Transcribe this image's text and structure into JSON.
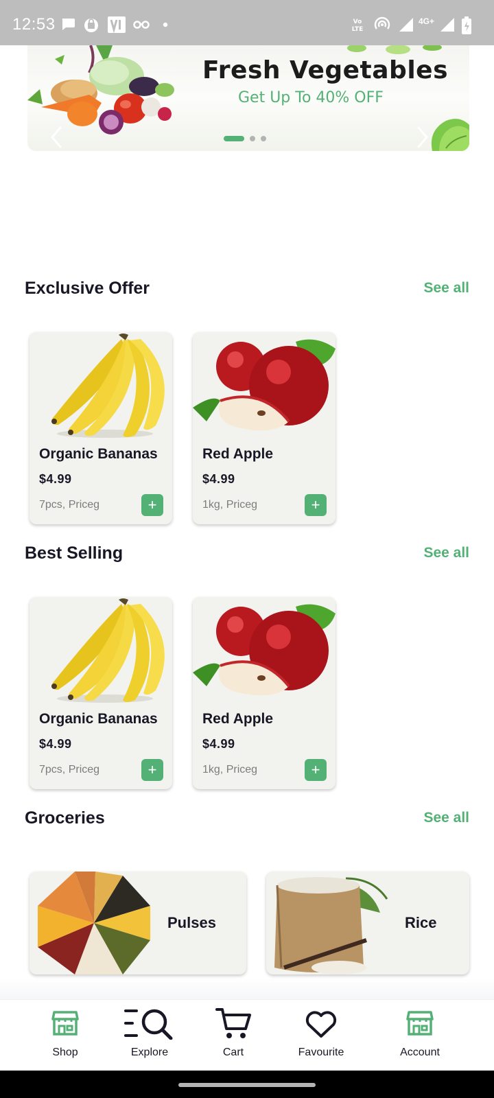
{
  "status_bar": {
    "time": "12:53",
    "network": "4G+",
    "volte": "Vo LTE"
  },
  "banner": {
    "title": "Fresh Vegetables",
    "subtitle": "Get Up To 40% OFF",
    "slide_count": 3,
    "active_slide": 0
  },
  "sections": {
    "exclusive": {
      "title": "Exclusive Offer",
      "see_all": "See all",
      "products": [
        {
          "name": "Organic Bananas",
          "price": "$4.99",
          "unit": "7pcs, Priceg",
          "add": "+"
        },
        {
          "name": "Red Apple",
          "price": "$4.99",
          "unit": "1kg, Priceg",
          "add": "+"
        }
      ]
    },
    "best_selling": {
      "title": "Best Selling",
      "see_all": "See all",
      "products": [
        {
          "name": "Organic Bananas",
          "price": "$4.99",
          "unit": "7pcs, Priceg",
          "add": "+"
        },
        {
          "name": "Red Apple",
          "price": "$4.99",
          "unit": "1kg, Priceg",
          "add": "+"
        }
      ]
    },
    "groceries": {
      "title": "Groceries",
      "see_all": "See all",
      "items": [
        {
          "label": "Pulses"
        },
        {
          "label": "Rice"
        }
      ]
    }
  },
  "bottom_nav": {
    "items": [
      {
        "label": "Shop",
        "icon": "store-icon"
      },
      {
        "label": "Explore",
        "icon": "explore-search-icon"
      },
      {
        "label": "Cart",
        "icon": "cart-icon"
      },
      {
        "label": "Favourite",
        "icon": "heart-icon"
      },
      {
        "label": "Account",
        "icon": "store-icon"
      }
    ]
  },
  "colors": {
    "accent": "#53b175",
    "text": "#181725",
    "muted": "#7c7c7c",
    "card_bg": "#f2f3ee"
  }
}
